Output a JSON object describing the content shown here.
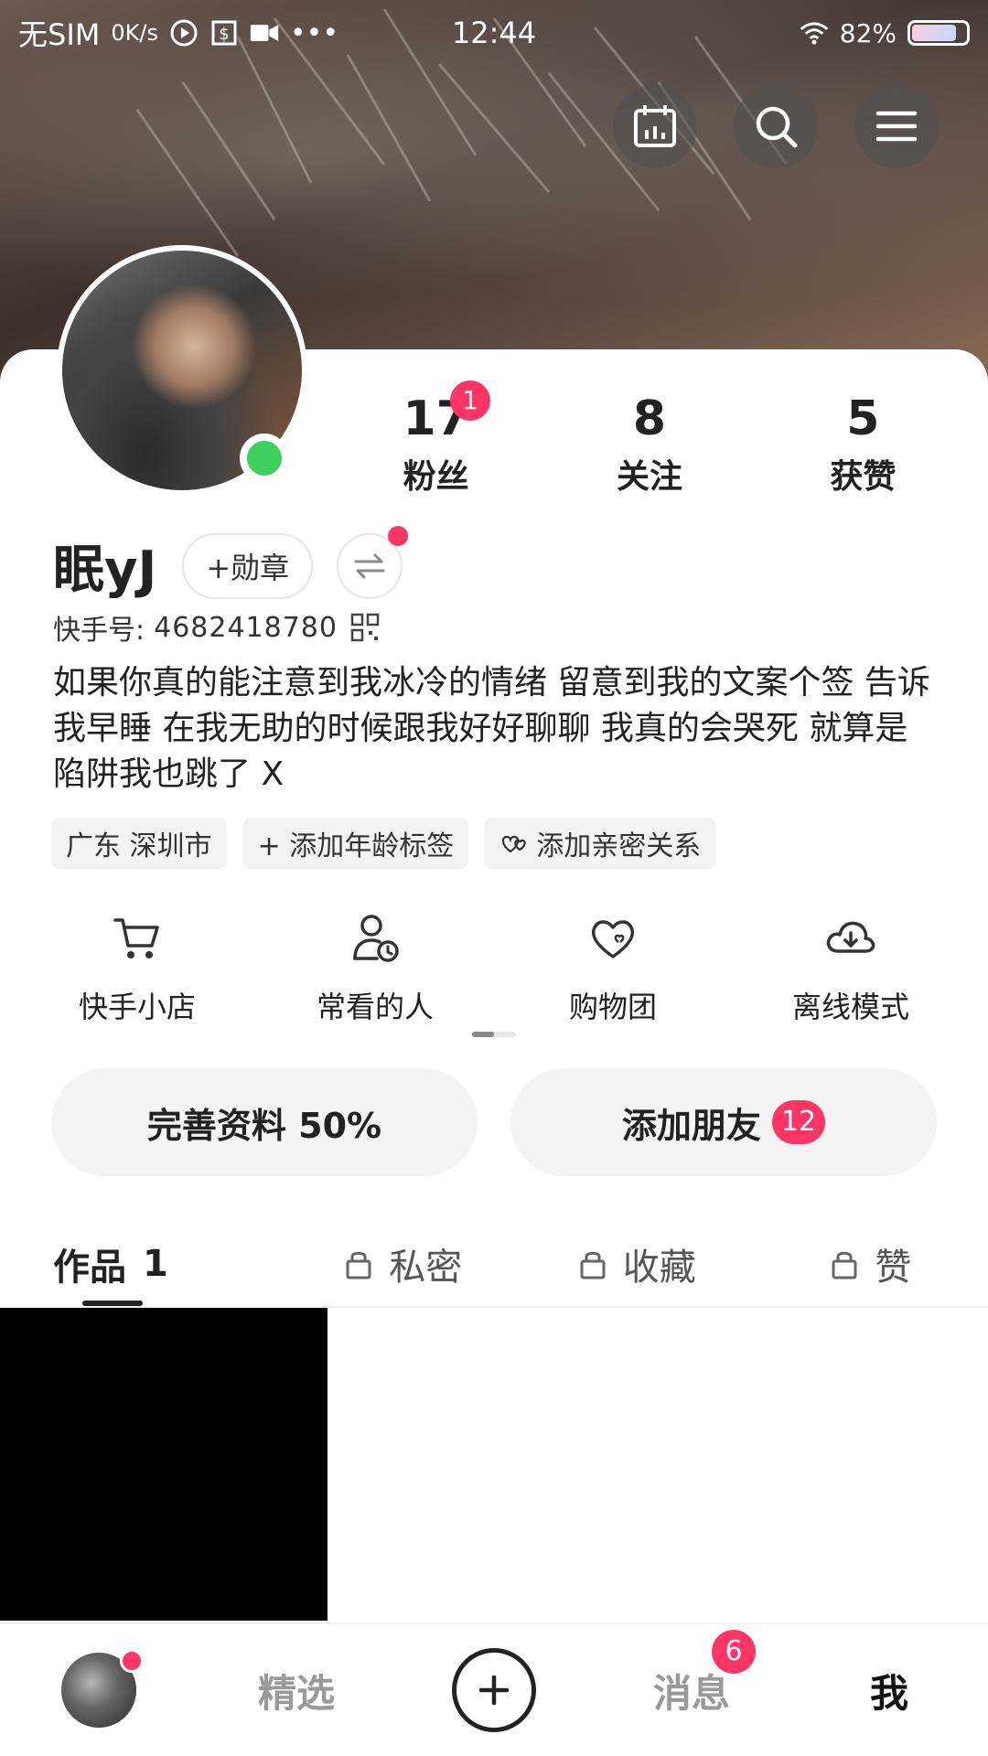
{
  "status_bar": {
    "carrier": "无SIM",
    "net_speed": "0K/s",
    "more": "•••",
    "time": "12:44",
    "battery": "82%",
    "battery_level": 0.82,
    "icons": [
      "play-circle-icon",
      "dollar-box-icon",
      "video-camera-icon",
      "wifi-icon",
      "battery-icon"
    ]
  },
  "top_actions": {
    "icons": [
      "calendar-icon",
      "search-icon",
      "menu-icon"
    ]
  },
  "profile": {
    "username": "眠yJ",
    "medal_label": "+勋章",
    "kuaishou_id_label": "快手号:",
    "kuaishou_id": "4682418780",
    "bio": "如果你真的能注意到我冰冷的情绪 留意到我的文案个签 告诉我早睡 在我无助的时候跟我好好聊聊 我真的会哭死 就算是陷阱我也跳了 X",
    "online_color": "#3fcf5c"
  },
  "stats": [
    {
      "value": "17",
      "label": "粉丝",
      "badge": "1"
    },
    {
      "value": "8",
      "label": "关注"
    },
    {
      "value": "5",
      "label": "获赞"
    }
  ],
  "tags": [
    {
      "label": "广东 深圳市"
    },
    {
      "label": "+ 添加年龄标签"
    },
    {
      "label": "添加亲密关系",
      "icon": "hearts-icon"
    }
  ],
  "tools": [
    {
      "label": "快手小店",
      "icon": "cart-icon"
    },
    {
      "label": "常看的人",
      "icon": "user-clock-icon"
    },
    {
      "label": "购物团",
      "icon": "heart-icon"
    },
    {
      "label": "离线模式",
      "icon": "cloud-download-icon"
    }
  ],
  "actions": {
    "complete_profile": "完善资料 50%",
    "add_friend": "添加朋友",
    "add_friend_badge": "12"
  },
  "tabs": [
    {
      "label": "作品",
      "count": "1",
      "active": true
    },
    {
      "label": "私密",
      "icon": "lock-icon"
    },
    {
      "label": "收藏",
      "icon": "lock-icon"
    },
    {
      "label": "赞",
      "icon": "lock-icon"
    }
  ],
  "nav": {
    "featured": "精选",
    "messages": "消息",
    "messages_badge": "6",
    "me": "我"
  },
  "colors": {
    "accent": "#fe3666",
    "text": "#222222"
  }
}
